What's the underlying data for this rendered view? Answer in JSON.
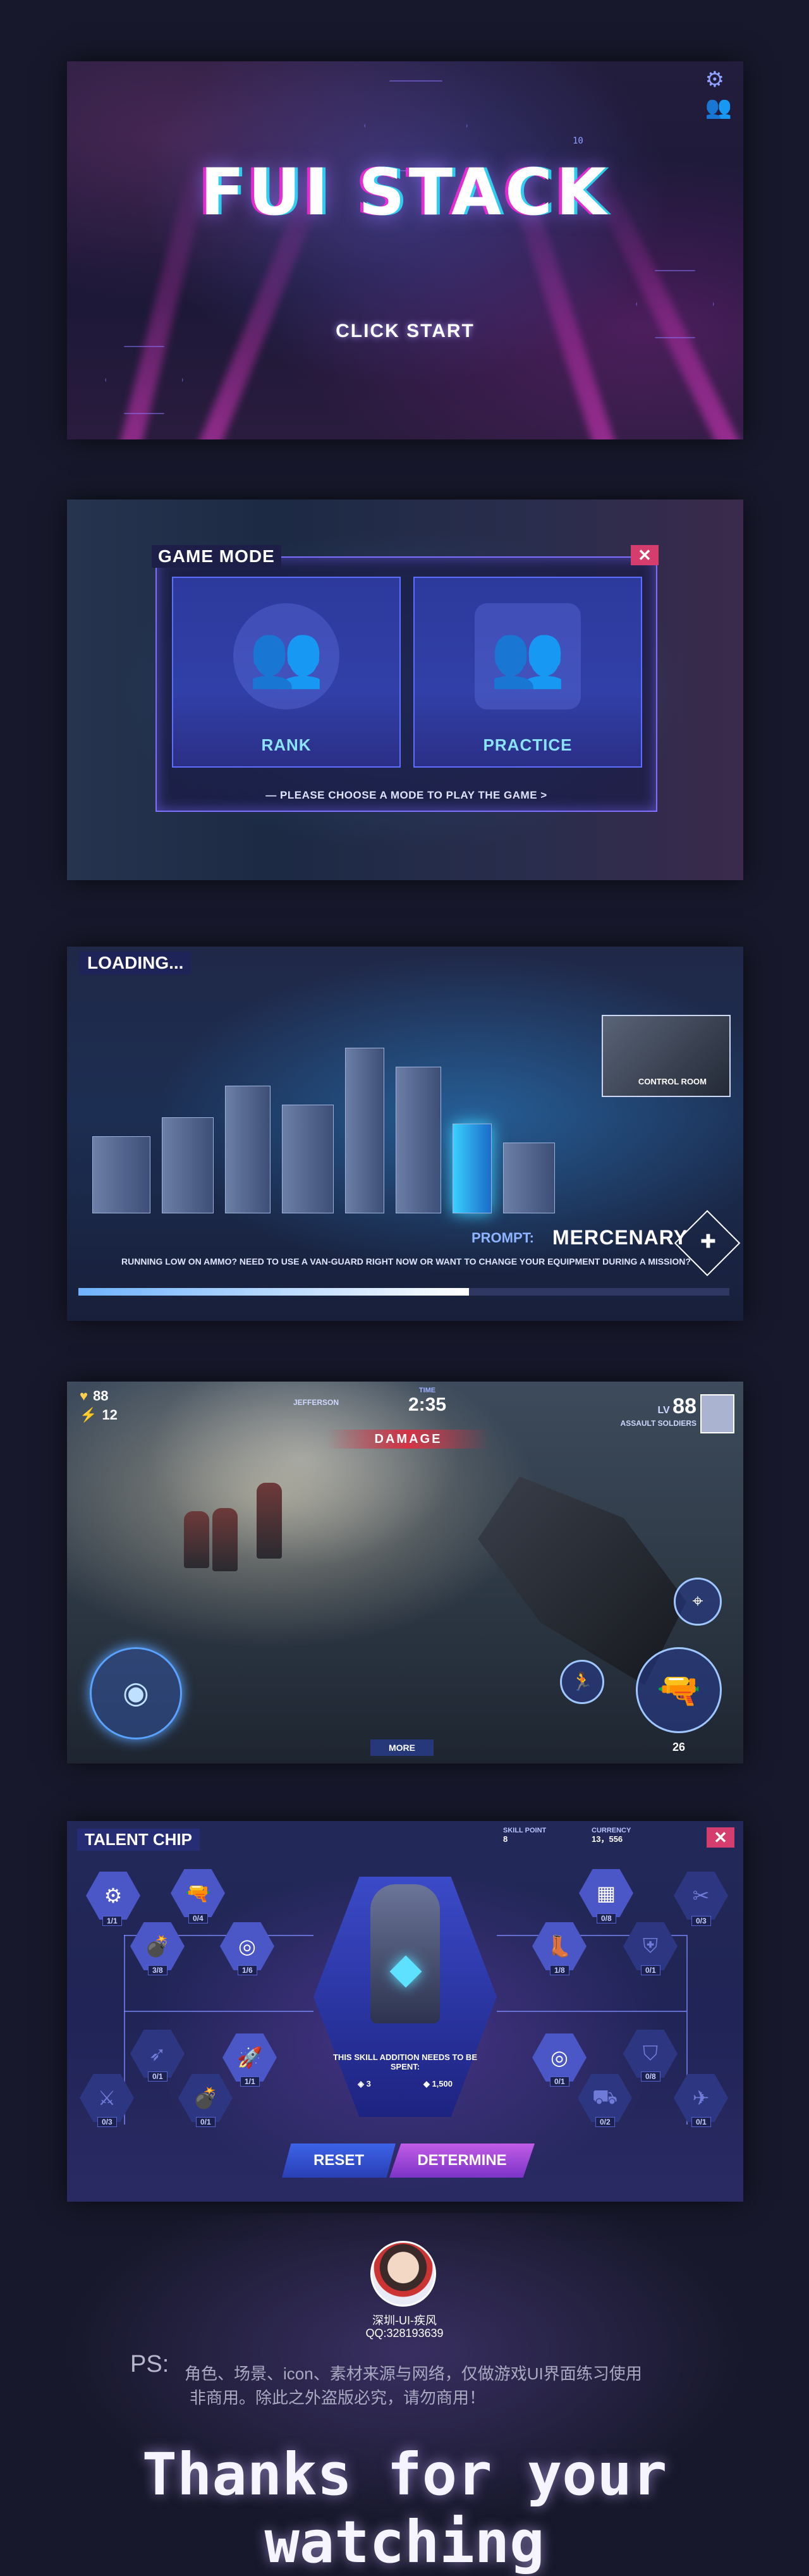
{
  "panel1": {
    "title": "FUI STACK",
    "click_start": "CLICK START",
    "number_tag": "10",
    "icons": [
      "gear-icon",
      "users-icon"
    ]
  },
  "panel2": {
    "title": "GAME MODE",
    "close": "✕",
    "modes": [
      {
        "label": "RANK",
        "icon": "team-three-icon"
      },
      {
        "label": "PRACTICE",
        "icon": "team-two-icon"
      }
    ],
    "hint": "— PLEASE CHOOSE A MODE TO PLAY THE GAME >"
  },
  "panel3": {
    "title": "LOADING...",
    "control_room": "CONTROL ROOM",
    "prompt_label": "PROMPT:",
    "prompt_value": "MERCENARY",
    "tip": "RUNNING LOW ON AMMO? NEED TO USE A VAN-GUARD RIGHT NOW OR WANT TO CHANGE YOUR EQUIPMENT DURING A MISSION?",
    "progress": 0.6
  },
  "panel4": {
    "health": "88",
    "energy": "12",
    "time_label": "TIME",
    "timer": "2:35",
    "location": "JEFFERSON",
    "damage": "DAMAGE",
    "lv_label": "LV",
    "lv_value": "88",
    "role": "ASSAULT SOLDIERS",
    "more": "MORE",
    "ammo": "26"
  },
  "panel5": {
    "title": "TALENT CHIP",
    "skill_point_label": "SKILL POINT",
    "skill_point_value": "8",
    "currency_label": "CURRENCY",
    "currency_value": "13，556",
    "close": "✕",
    "message": "THIS SKILL ADDITION NEEDS TO BE SPENT:",
    "cost_points": "3",
    "cost_currency": "1,500",
    "reset": "RESET",
    "determine": "DETERMINE",
    "nodes_left": [
      {
        "count": "1/1"
      },
      {
        "count": "0/4"
      },
      {
        "count": "3/8"
      },
      {
        "count": "1/6"
      },
      {
        "count": "0/1"
      },
      {
        "count": "0/3"
      },
      {
        "count": "1/1"
      },
      {
        "count": "0/1"
      }
    ],
    "nodes_right": [
      {
        "count": "0/3"
      },
      {
        "count": "0/8"
      },
      {
        "count": "1/8"
      },
      {
        "count": "0/1"
      },
      {
        "count": "0/1"
      },
      {
        "count": "0/8"
      },
      {
        "count": "0/2"
      },
      {
        "count": "0/1"
      }
    ]
  },
  "footer": {
    "author": "深圳-UI-疾风",
    "qq": "QQ:328193639",
    "ps_label": "PS:",
    "ps_line1": "角色、场景、icon、素材来源与网络，仅做游戏UI界面练习使用",
    "ps_line2": "非商用。除此之外盗版必究，请勿商用！",
    "thanks": "Thanks for your watching"
  }
}
